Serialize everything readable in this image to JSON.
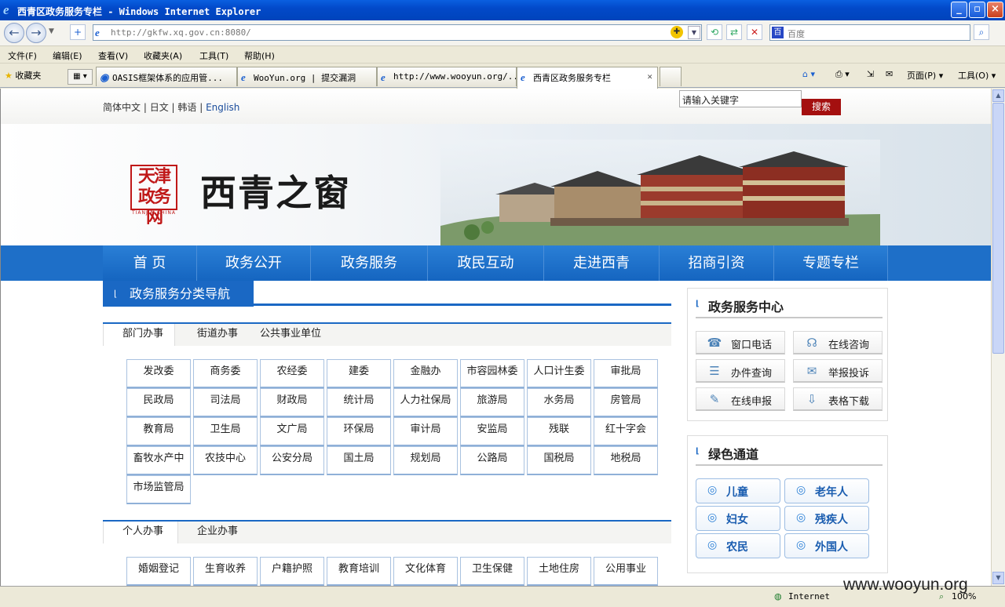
{
  "window": {
    "title": "西青区政务服务专栏 - Windows Internet Explorer"
  },
  "address": {
    "url": "http://gkfw.xq.gov.cn:8080/",
    "search_placeholder": "百度"
  },
  "menu": [
    "文件(F)",
    "编辑(E)",
    "查看(V)",
    "收藏夹(A)",
    "工具(T)",
    "帮助(H)"
  ],
  "favorites": "收藏夹",
  "tabs": [
    {
      "label": "OASIS框架体系的应用管..."
    },
    {
      "label": "WooYun.org | 提交漏洞"
    },
    {
      "label": "http://www.wooyun.org/..."
    },
    {
      "label": "西青区政务服务专栏",
      "active": true
    }
  ],
  "toolbar_right": {
    "page": "页面(P)",
    "tools": "工具(O)"
  },
  "site": {
    "langs": [
      "简体中文",
      "日文",
      "韩语",
      "English"
    ],
    "search_input": "请输入关键字",
    "search_button": "搜索",
    "logo_text": "天津政务网",
    "logo_sub": "TIANJIN CHINA",
    "title": "西青之窗",
    "nav": [
      "首 页",
      "政务公开",
      "政务服务",
      "政民互动",
      "走进西青",
      "招商引资",
      "专题专栏"
    ],
    "section_title": "政务服务分类导航",
    "dept_tabs": [
      "部门办事",
      "街道办事",
      "公共事业单位"
    ],
    "depts": [
      "发改委",
      "商务委",
      "农经委",
      "建委",
      "金融办",
      "市容园林委",
      "人口计生委",
      "审批局",
      "民政局",
      "司法局",
      "财政局",
      "统计局",
      "人力社保局",
      "旅游局",
      "水务局",
      "房管局",
      "教育局",
      "卫生局",
      "文广局",
      "环保局",
      "审计局",
      "安监局",
      "残联",
      "红十字会",
      "畜牧水产中",
      "农技中心",
      "公安分局",
      "国土局",
      "规划局",
      "公路局",
      "国税局",
      "地税局",
      "市场监管局"
    ],
    "person_tabs": [
      "个人办事",
      "企业办事"
    ],
    "person_items": [
      "婚姻登记",
      "生育收养",
      "户籍护照",
      "教育培训",
      "文化体育",
      "卫生保健",
      "土地住房",
      "公用事业"
    ],
    "service_center": {
      "title": "政务服务中心",
      "items": [
        "窗口电话",
        "在线咨询",
        "办件查询",
        "举报投诉",
        "在线申报",
        "表格下载"
      ]
    },
    "green": {
      "title": "绿色通道",
      "items": [
        "儿童",
        "老年人",
        "妇女",
        "残疾人",
        "农民",
        "外国人"
      ]
    }
  },
  "status": {
    "zone": "Internet",
    "zoom": "100%",
    "watermark": "www.wooyun.org"
  }
}
